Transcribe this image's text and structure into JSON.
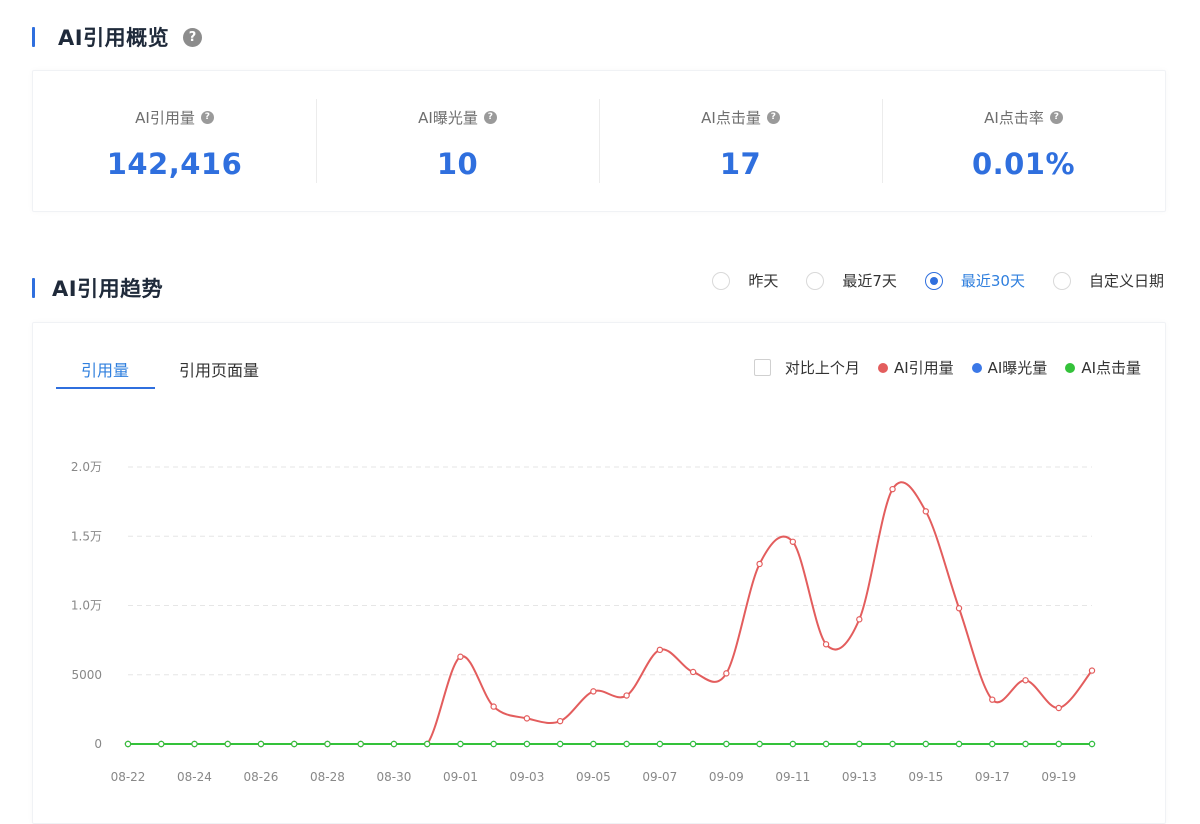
{
  "overview": {
    "title": "AI引用概览",
    "metrics": [
      {
        "label": "AI引用量",
        "value": "142,416"
      },
      {
        "label": "AI曝光量",
        "value": "10"
      },
      {
        "label": "AI点击量",
        "value": "17"
      },
      {
        "label": "AI点击率",
        "value": "0.01%"
      }
    ]
  },
  "trend": {
    "title": "AI引用趋势",
    "ranges": [
      {
        "label": "昨天",
        "selected": false
      },
      {
        "label": "最近7天",
        "selected": false
      },
      {
        "label": "最近30天",
        "selected": true
      },
      {
        "label": "自定义日期",
        "selected": false
      }
    ],
    "tabs": [
      {
        "label": "引用量",
        "active": true
      },
      {
        "label": "引用页面量",
        "active": false
      }
    ],
    "compare_label": "对比上个月",
    "help_glyph": "?"
  },
  "colors": {
    "accent": "#2f6fde",
    "series_citations": "#e35d5d",
    "series_exposure": "#3b78e7",
    "series_clicks": "#34c23a"
  },
  "chart_data": {
    "type": "line",
    "x": [
      "08-22",
      "08-23",
      "08-24",
      "08-25",
      "08-26",
      "08-27",
      "08-28",
      "08-29",
      "08-30",
      "08-31",
      "09-01",
      "09-02",
      "09-03",
      "09-04",
      "09-05",
      "09-06",
      "09-07",
      "09-08",
      "09-09",
      "09-10",
      "09-11",
      "09-12",
      "09-13",
      "09-14",
      "09-15",
      "09-16",
      "09-17",
      "09-18",
      "09-19",
      "09-20"
    ],
    "x_tick_labels": [
      "08-22",
      "08-24",
      "08-26",
      "08-28",
      "08-30",
      "09-01",
      "09-03",
      "09-05",
      "09-07",
      "09-09",
      "09-11",
      "09-13",
      "09-15",
      "09-17",
      "09-19"
    ],
    "y_tick_labels": [
      "0",
      "5000",
      "1.0万",
      "1.5万",
      "2.0万"
    ],
    "ylim": [
      0,
      20000
    ],
    "grid": true,
    "smooth": true,
    "series": [
      {
        "name": "AI引用量",
        "color": "#e35d5d",
        "values": [
          0,
          0,
          0,
          0,
          0,
          0,
          0,
          0,
          0,
          0,
          6300,
          2700,
          1850,
          1650,
          3800,
          3500,
          6800,
          5200,
          5100,
          13000,
          14600,
          7200,
          9000,
          18400,
          16800,
          9800,
          3200,
          4600,
          2600,
          5300
        ]
      },
      {
        "name": "AI曝光量",
        "color": "#3b78e7",
        "values": [
          0,
          0,
          0,
          0,
          0,
          0,
          0,
          0,
          0,
          0,
          0,
          0,
          0,
          0,
          0,
          0,
          0,
          0,
          0,
          0,
          0,
          0,
          0,
          0,
          0,
          0,
          0,
          0,
          0,
          0
        ]
      },
      {
        "name": "AI点击量",
        "color": "#34c23a",
        "values": [
          0,
          0,
          0,
          0,
          0,
          0,
          0,
          0,
          0,
          0,
          0,
          0,
          0,
          0,
          0,
          0,
          0,
          0,
          0,
          0,
          0,
          0,
          0,
          0,
          0,
          0,
          0,
          0,
          0,
          0
        ]
      }
    ]
  }
}
